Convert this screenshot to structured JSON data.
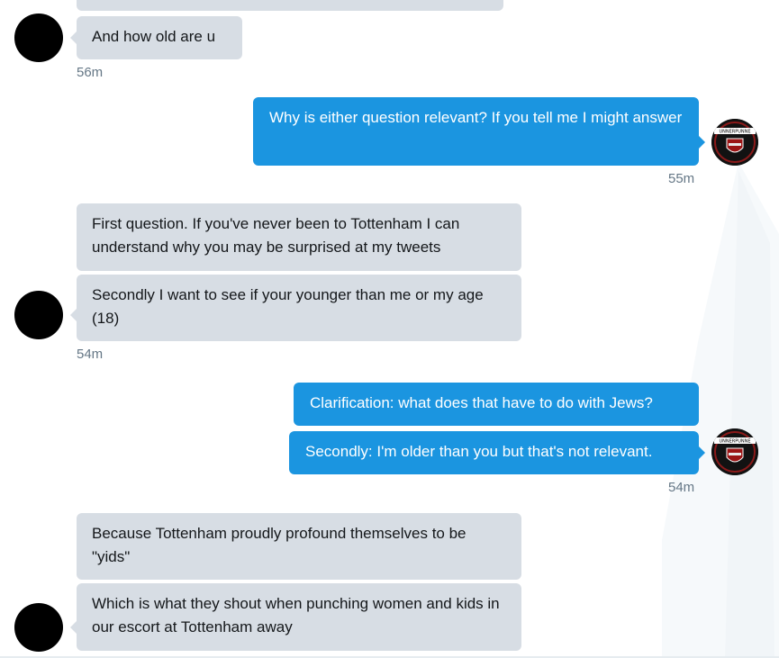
{
  "conversation": {
    "received_group_1": {
      "messages": [
        "And how old are u"
      ],
      "time": "56m"
    },
    "sent_group_1": {
      "messages": [
        "Why is either question relevant? If you tell me I might answer"
      ],
      "time": "55m"
    },
    "received_group_2": {
      "messages": [
        "First question. If you've never been to Tottenham I can understand why you may be surprised at my tweets",
        "Secondly I want to see if your younger than me or my age (18)"
      ],
      "time": "54m"
    },
    "sent_group_2": {
      "messages": [
        "Clarification: what does that have to do with Jews?",
        "Secondly: I'm older than you but that's not relevant."
      ],
      "time": "54m"
    },
    "received_group_3": {
      "messages": [
        "Because Tottenham proudly profound themselves to be \"yids\"",
        "Which is what they shout when punching women and kids in our escort at Tottenham away"
      ]
    }
  },
  "avatar_me": {
    "badge_text": "UNNERPUNNE",
    "icon": "arsenal-crest-icon"
  },
  "colors": {
    "sent_bubble": "#1b95e0",
    "received_bubble": "#d7dde4",
    "timestamp": "#657786"
  }
}
